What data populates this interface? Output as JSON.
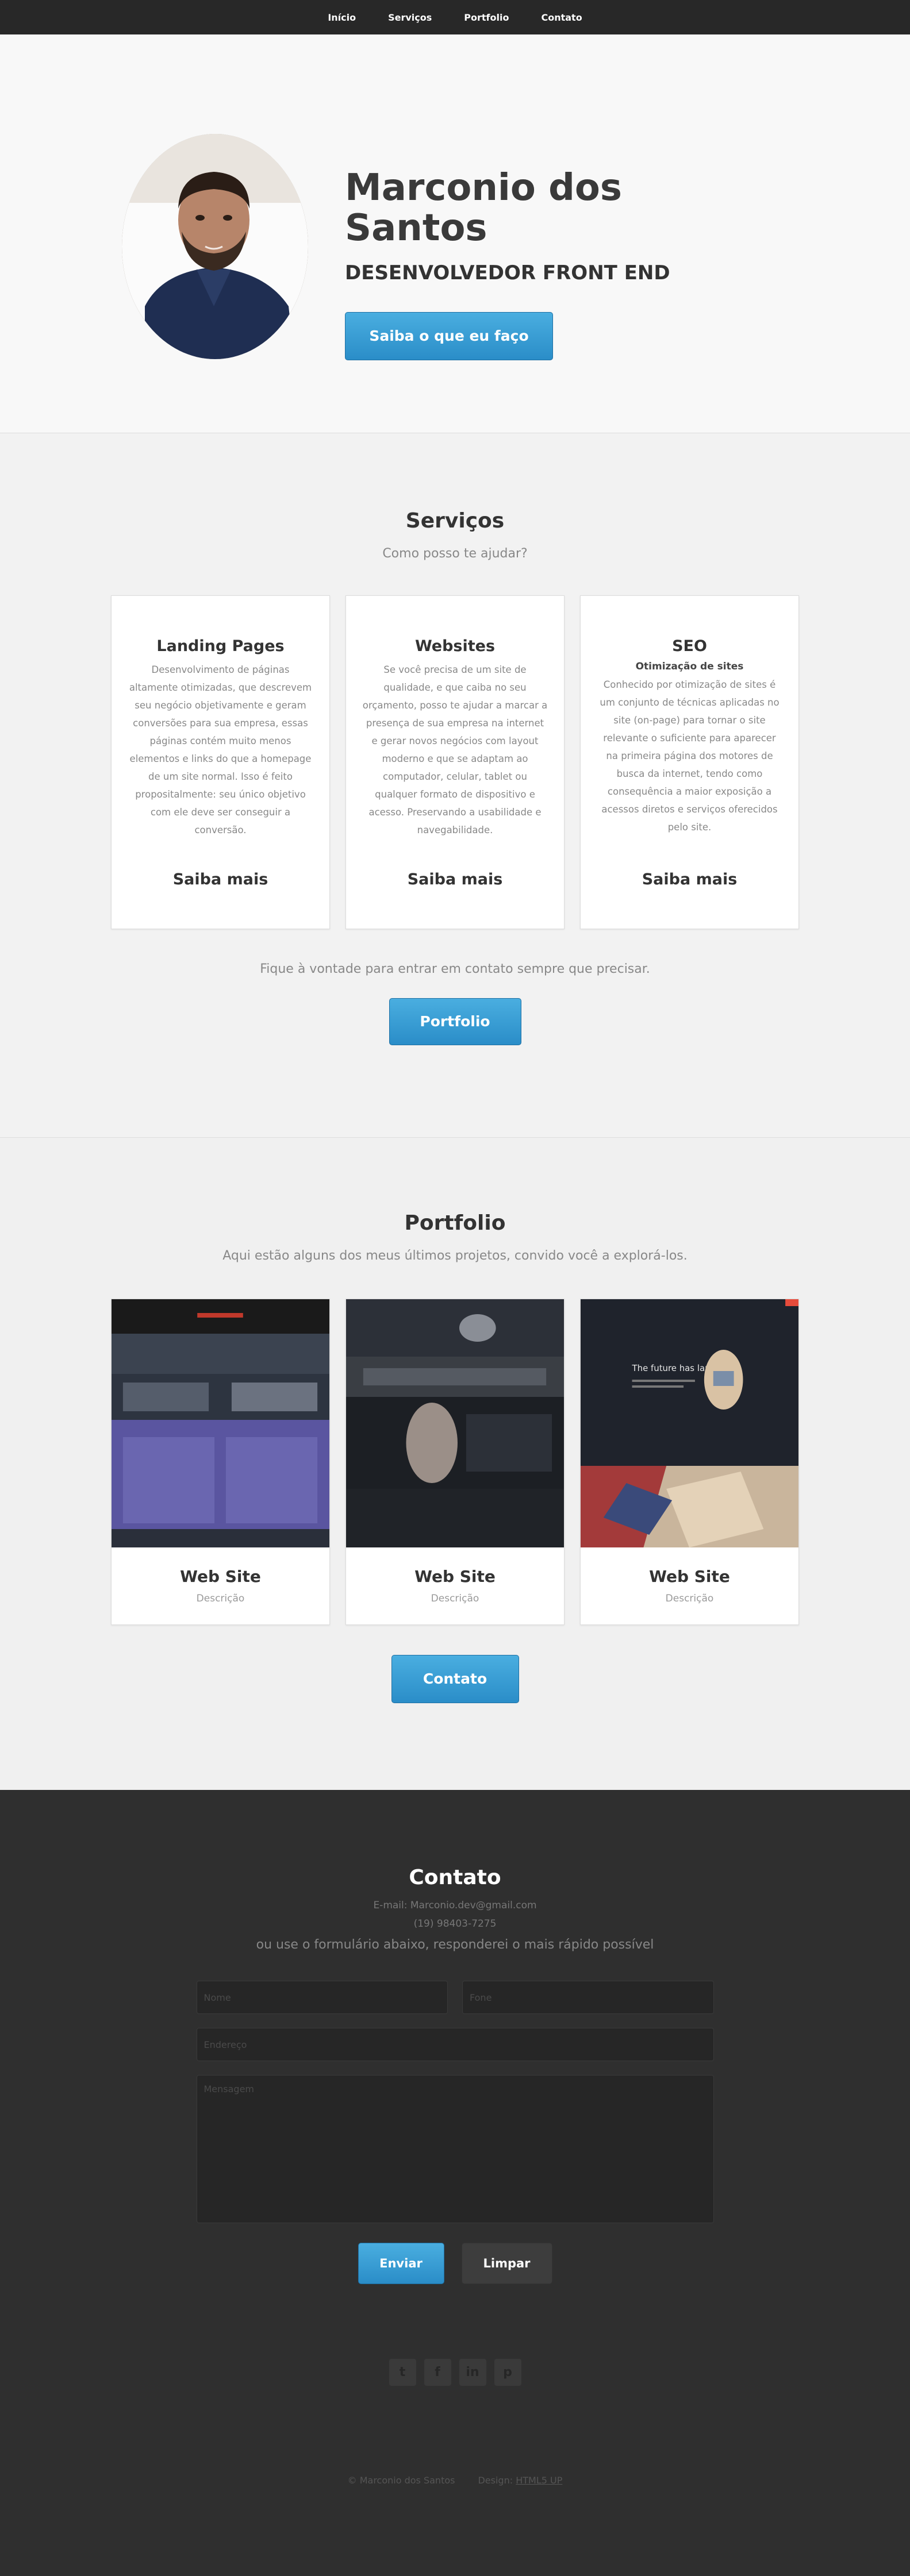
{
  "nav": {
    "items": [
      "Início",
      "Serviços",
      "Portfolio",
      "Contato"
    ]
  },
  "hero": {
    "name": "Marconio dos Santos",
    "role": "DESENVOLVEDOR FRONT END",
    "button": "Saiba o que eu faço"
  },
  "services": {
    "title": "Serviços",
    "subtitle": "Como posso te ajudar?",
    "cards": [
      {
        "title": "Landing Pages",
        "subtitle": "",
        "body": "Desenvolvimento de páginas altamente otimizadas, que descrevem seu negócio objetivamente e geram conversões para sua empresa, essas páginas contém muito menos elementos e links do que a homepage de um site normal. Isso é feito propositalmente: seu único objetivo com ele deve ser conseguir a conversão.",
        "more": "Saiba mais"
      },
      {
        "title": "Websites",
        "subtitle": "",
        "body": "Se você precisa de um site de qualidade, e que caiba no seu orçamento, posso te ajudar a marcar a presença de sua empresa na internet e gerar novos negócios com layout moderno e que se adaptam ao computador, celular, tablet ou qualquer formato de dispositivo e acesso. Preservando a usabilidade e navegabilidade.",
        "more": "Saiba mais"
      },
      {
        "title": "SEO",
        "subtitle": "Otimização de sites",
        "body": "Conhecido por otimização de sites é um conjunto de técnicas aplicadas no site (on-page) para tornar o site relevante o suficiente para aparecer na primeira página dos motores de busca da internet, tendo como consequência a maior exposição a acessos diretos e serviços oferecidos pelo site.",
        "more": "Saiba mais"
      }
    ],
    "note": "Fique à vontade para entrar em contato sempre que precisar.",
    "button": "Portfolio"
  },
  "portfolio": {
    "title": "Portfolio",
    "subtitle": "Aqui estão alguns dos meus últimos projetos, convido você a explorá-los.",
    "items": [
      {
        "title": "Web Site",
        "desc": "Descrição"
      },
      {
        "title": "Web Site",
        "desc": "Descrição"
      },
      {
        "title": "Web Site",
        "desc": "Descrição"
      }
    ],
    "thumb3_text": "The future has landed",
    "button": "Contato"
  },
  "contact": {
    "title": "Contato",
    "email_line": "E-mail: Marconio.dev@gmail.com",
    "phone_line": "(19) 98403-7275",
    "lead": "ou use o formulário abaixo, responderei o mais rápido possível",
    "name_placeholder": "Nome",
    "phone_placeholder": "Fone",
    "email_placeholder": "Endereço",
    "message_placeholder": "Mensagem",
    "send": "Enviar",
    "clear": "Limpar"
  },
  "socials": [
    {
      "icon": "twitter-icon",
      "glyph": "t"
    },
    {
      "icon": "facebook-icon",
      "glyph": "f"
    },
    {
      "icon": "linkedin-icon",
      "glyph": "in"
    },
    {
      "icon": "pinterest-icon",
      "glyph": "p"
    }
  ],
  "footer": {
    "copyright": "© Marconio dos Santos",
    "design_label": "Design:",
    "design_link": "HTML5 UP"
  },
  "colors": {
    "nav_bg": "#282828",
    "accent": "#2a8dc8",
    "contact_bg": "#2f2f2f"
  }
}
